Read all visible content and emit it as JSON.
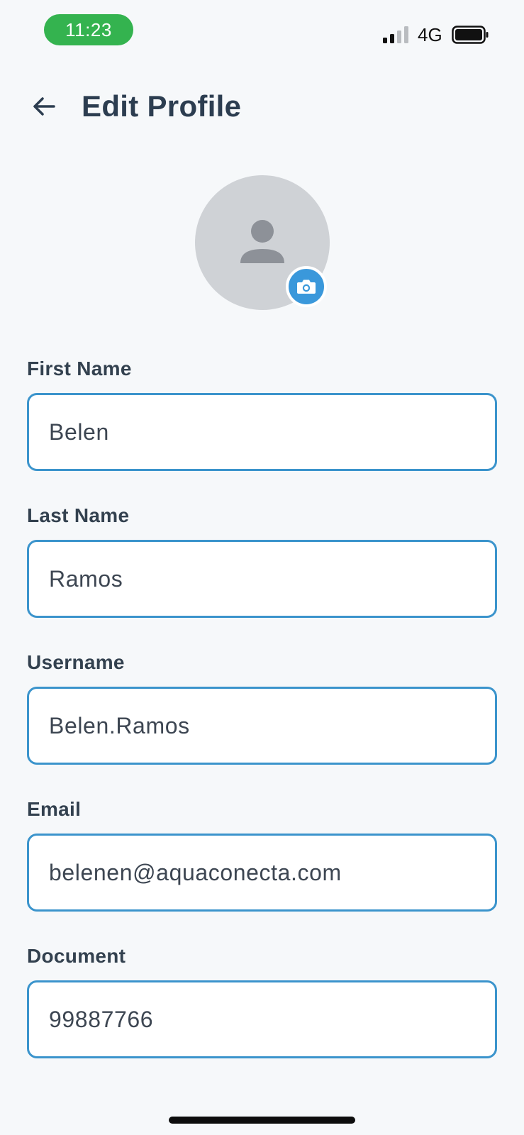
{
  "status_bar": {
    "time": "11:23",
    "network": "4G",
    "time_pill_color": "#34b34f"
  },
  "header": {
    "title": "Edit Profile",
    "back_icon": "arrow-left-icon"
  },
  "avatar": {
    "placeholder_icon": "person-icon",
    "edit_icon": "camera-icon",
    "accent_color": "#3a98db"
  },
  "form": {
    "fields": [
      {
        "label": "First Name",
        "value": "Belen"
      },
      {
        "label": "Last Name",
        "value": "Ramos"
      },
      {
        "label": "Username",
        "value": "Belen.Ramos"
      },
      {
        "label": "Email",
        "value": "belenen@aquaconecta.com"
      },
      {
        "label": "Document",
        "value": "99887766"
      }
    ],
    "border_color": "#3b94cc"
  }
}
